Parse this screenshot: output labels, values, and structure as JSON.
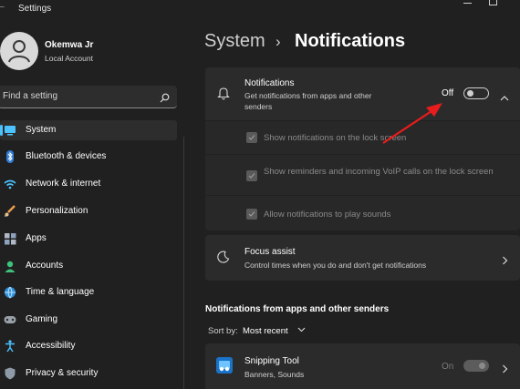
{
  "window": {
    "title": "Settings"
  },
  "user": {
    "name": "Okemwa Jr",
    "account_type": "Local Account"
  },
  "search": {
    "placeholder": "Find a setting"
  },
  "sidebar": {
    "items": [
      {
        "label": "System",
        "icon": "monitor-icon",
        "active": true
      },
      {
        "label": "Bluetooth & devices",
        "icon": "bluetooth-icon"
      },
      {
        "label": "Network & internet",
        "icon": "wifi-icon"
      },
      {
        "label": "Personalization",
        "icon": "brush-icon"
      },
      {
        "label": "Apps",
        "icon": "apps-icon"
      },
      {
        "label": "Accounts",
        "icon": "person-icon"
      },
      {
        "label": "Time & language",
        "icon": "globe-icon"
      },
      {
        "label": "Gaming",
        "icon": "gamepad-icon"
      },
      {
        "label": "Accessibility",
        "icon": "accessibility-icon"
      },
      {
        "label": "Privacy & security",
        "icon": "shield-icon"
      }
    ]
  },
  "breadcrumb": {
    "parent": "System",
    "separator": "›",
    "current": "Notifications"
  },
  "notifications": {
    "title": "Notifications",
    "description": "Get notifications from apps and other senders",
    "toggle_state": "Off",
    "options": [
      {
        "label": "Show notifications on the lock screen",
        "checked": true
      },
      {
        "label": "Show reminders and incoming VoIP calls on the lock screen",
        "checked": true
      },
      {
        "label": "Allow notifications to play sounds",
        "checked": true
      }
    ]
  },
  "focus_assist": {
    "title": "Focus assist",
    "description": "Control times when you do and don't get notifications"
  },
  "senders": {
    "heading": "Notifications from apps and other senders",
    "sort_prefix": "Sort by:",
    "sort_value": "Most recent",
    "apps": [
      {
        "name": "Snipping Tool",
        "detail": "Banners, Sounds",
        "toggle_state": "On"
      }
    ]
  },
  "colors": {
    "accent": "#4cc2ff",
    "annotation_arrow": "#e81c1c"
  }
}
